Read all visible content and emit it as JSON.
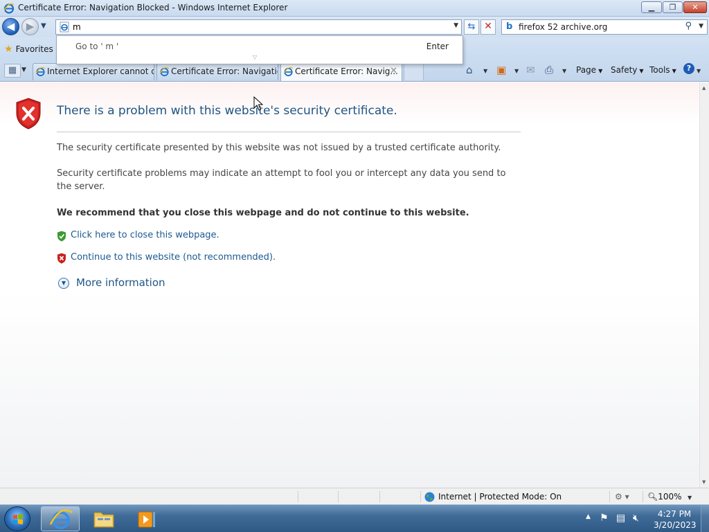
{
  "window": {
    "title": "Certificate Error: Navigation Blocked - Windows Internet Explorer",
    "minimize_glyph": "▁",
    "maximize_glyph": "❐",
    "close_glyph": "✕"
  },
  "nav": {
    "back_glyph": "◀",
    "forward_glyph": "▶",
    "address_value": "m",
    "search_value": "firefox 52 archive.org",
    "search_provider_icon": "bing-icon"
  },
  "autocomplete": {
    "goto_text": "Go to ' m '",
    "enter_text": "Enter"
  },
  "favorites": {
    "label": "Favorites"
  },
  "tabs": [
    {
      "label": "Internet Explorer cannot di..."
    },
    {
      "label": "Certificate Error: Navigatio..."
    },
    {
      "label": "Certificate Error: Navig...",
      "active": true
    }
  ],
  "command_bar": {
    "page_label": "Page",
    "safety_label": "Safety",
    "tools_label": "Tools"
  },
  "content": {
    "heading": "There is a problem with this website's security certificate.",
    "para1": "The security certificate presented by this website was not issued by a trusted certificate authority.",
    "para2": "Security certificate problems may indicate an attempt to fool you or intercept any data you send to the server.",
    "recommend": "We recommend that you close this webpage and do not continue to this website.",
    "close_link": "Click here to close this webpage.",
    "continue_link": "Continue to this website (not recommended).",
    "more_info": "More information"
  },
  "statusbar": {
    "zone": "Internet | Protected Mode: On",
    "zoom": "100%"
  },
  "taskbar": {
    "time": "4:27 PM",
    "date": "3/20/2023"
  },
  "colors": {
    "heading": "#1f5585",
    "link": "#1c5991",
    "shield_red": "#c8201e",
    "shield_green": "#3a9a32"
  }
}
